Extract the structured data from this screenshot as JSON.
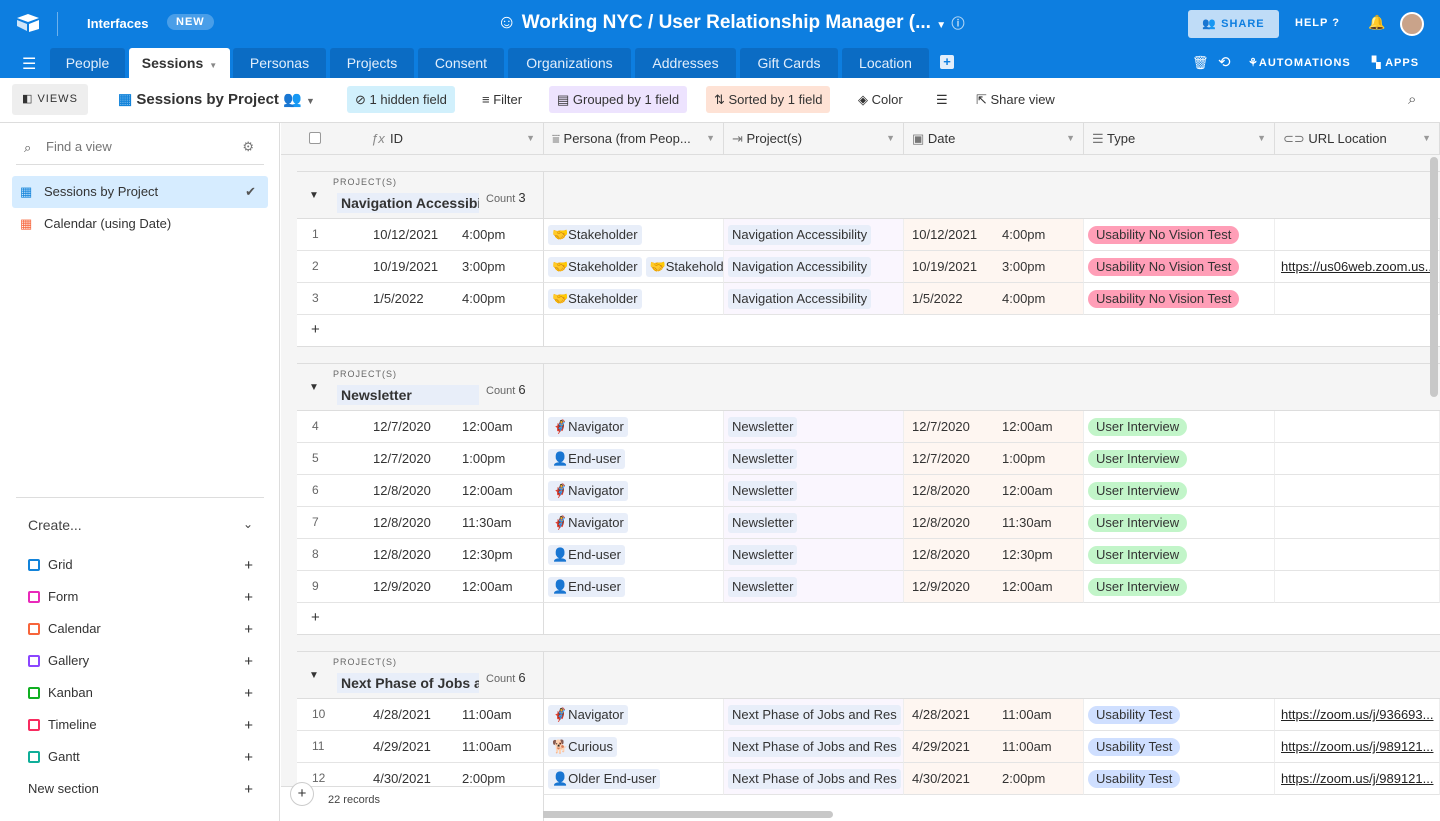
{
  "app": {
    "interfaces": "Interfaces",
    "new_badge": "NEW",
    "title": "Working NYC / User Relationship Manager (...",
    "share": "SHARE",
    "help": "HELP",
    "automations": "AUTOMATIONS",
    "apps": "APPS"
  },
  "tabs": [
    {
      "label": "People"
    },
    {
      "label": "Sessions",
      "active": true
    },
    {
      "label": "Personas"
    },
    {
      "label": "Projects"
    },
    {
      "label": "Consent"
    },
    {
      "label": "Organizations"
    },
    {
      "label": "Addresses"
    },
    {
      "label": "Gift Cards"
    },
    {
      "label": "Location"
    }
  ],
  "toolbar": {
    "views": "VIEWS",
    "view_name": "Sessions by Project",
    "hidden": "1 hidden field",
    "filter": "Filter",
    "grouped": "Grouped by 1 field",
    "sorted": "Sorted by 1 field",
    "color": "Color",
    "share_view": "Share view"
  },
  "sidebar": {
    "find_placeholder": "Find a view",
    "views": [
      {
        "label": "Sessions by Project",
        "icon": "grid-icon",
        "selected": true
      },
      {
        "label": "Calendar (using Date)",
        "icon": "calendar-icon"
      }
    ],
    "create_label": "Create...",
    "create": [
      {
        "label": "Grid",
        "color": "#1283da"
      },
      {
        "label": "Form",
        "color": "#e929ba"
      },
      {
        "label": "Calendar",
        "color": "#f7653b"
      },
      {
        "label": "Gallery",
        "color": "#8b46ff"
      },
      {
        "label": "Kanban",
        "color": "#11af22"
      },
      {
        "label": "Timeline",
        "color": "#f82b60"
      },
      {
        "label": "Gantt",
        "color": "#0fae99"
      }
    ],
    "new_section": "New section"
  },
  "columns": [
    "ID",
    "Persona (from Peop...",
    "Project(s)",
    "Date",
    "Type",
    "URL Location"
  ],
  "group_label": "PROJECT(S)",
  "count_label": "Count",
  "groups": [
    {
      "name": "Navigation Accessibi",
      "count": "3",
      "rows": [
        {
          "n": "1",
          "d": "10/12/2021",
          "t": "4:00pm",
          "personas": [
            "🤝Stakeholder"
          ],
          "project": "Navigation Accessibility",
          "date": "10/12/2021",
          "time": "4:00pm",
          "type": "Usability No Vision Test",
          "url": ""
        },
        {
          "n": "2",
          "d": "10/19/2021",
          "t": "3:00pm",
          "personas": [
            "🤝Stakeholder",
            "🤝Stakeholder"
          ],
          "project": "Navigation Accessibility",
          "date": "10/19/2021",
          "time": "3:00pm",
          "type": "Usability No Vision Test",
          "url": "https://us06web.zoom.us..."
        },
        {
          "n": "3",
          "d": "1/5/2022",
          "t": "4:00pm",
          "personas": [
            "🤝Stakeholder"
          ],
          "project": "Navigation Accessibility",
          "date": "1/5/2022",
          "time": "4:00pm",
          "type": "Usability No Vision Test",
          "url": ""
        }
      ]
    },
    {
      "name": "Newsletter",
      "count": "6",
      "rows": [
        {
          "n": "4",
          "d": "12/7/2020",
          "t": "12:00am",
          "personas": [
            "🦸‍♀️Navigator"
          ],
          "project": "Newsletter",
          "date": "12/7/2020",
          "time": "12:00am",
          "type": "User Interview",
          "url": ""
        },
        {
          "n": "5",
          "d": "12/7/2020",
          "t": "1:00pm",
          "personas": [
            "👤End-user"
          ],
          "project": "Newsletter",
          "date": "12/7/2020",
          "time": "1:00pm",
          "type": "User Interview",
          "url": ""
        },
        {
          "n": "6",
          "d": "12/8/2020",
          "t": "12:00am",
          "personas": [
            "🦸‍♀️Navigator"
          ],
          "project": "Newsletter",
          "date": "12/8/2020",
          "time": "12:00am",
          "type": "User Interview",
          "url": ""
        },
        {
          "n": "7",
          "d": "12/8/2020",
          "t": "11:30am",
          "personas": [
            "🦸‍♀️Navigator"
          ],
          "project": "Newsletter",
          "date": "12/8/2020",
          "time": "11:30am",
          "type": "User Interview",
          "url": ""
        },
        {
          "n": "8",
          "d": "12/8/2020",
          "t": "12:30pm",
          "personas": [
            "👤End-user"
          ],
          "project": "Newsletter",
          "date": "12/8/2020",
          "time": "12:30pm",
          "type": "User Interview",
          "url": ""
        },
        {
          "n": "9",
          "d": "12/9/2020",
          "t": "12:00am",
          "personas": [
            "👤End-user"
          ],
          "project": "Newsletter",
          "date": "12/9/2020",
          "time": "12:00am",
          "type": "User Interview",
          "url": ""
        }
      ]
    },
    {
      "name": "Next Phase of Jobs a",
      "count": "6",
      "rows": [
        {
          "n": "10",
          "d": "4/28/2021",
          "t": "11:00am",
          "personas": [
            "🦸‍♀️Navigator"
          ],
          "project": "Next Phase of Jobs and Res",
          "date": "4/28/2021",
          "time": "11:00am",
          "type": "Usability Test",
          "url": "https://zoom.us/j/936693..."
        },
        {
          "n": "11",
          "d": "4/29/2021",
          "t": "11:00am",
          "personas": [
            "🐕Curious"
          ],
          "project": "Next Phase of Jobs and Res",
          "date": "4/29/2021",
          "time": "11:00am",
          "type": "Usability Test",
          "url": "https://zoom.us/j/989121..."
        },
        {
          "n": "12",
          "d": "4/30/2021",
          "t": "2:00pm",
          "personas": [
            "👤Older End-user"
          ],
          "project": "Next Phase of Jobs and Res",
          "date": "4/30/2021",
          "time": "2:00pm",
          "type": "Usability Test",
          "url": "https://zoom.us/j/989121..."
        }
      ]
    }
  ],
  "type_colors": {
    "Usability No Vision Test": "#ff9eb7",
    "User Interview": "#c2f5c9",
    "Usability Test": "#cfdfff"
  },
  "footer": {
    "records": "22 records"
  }
}
